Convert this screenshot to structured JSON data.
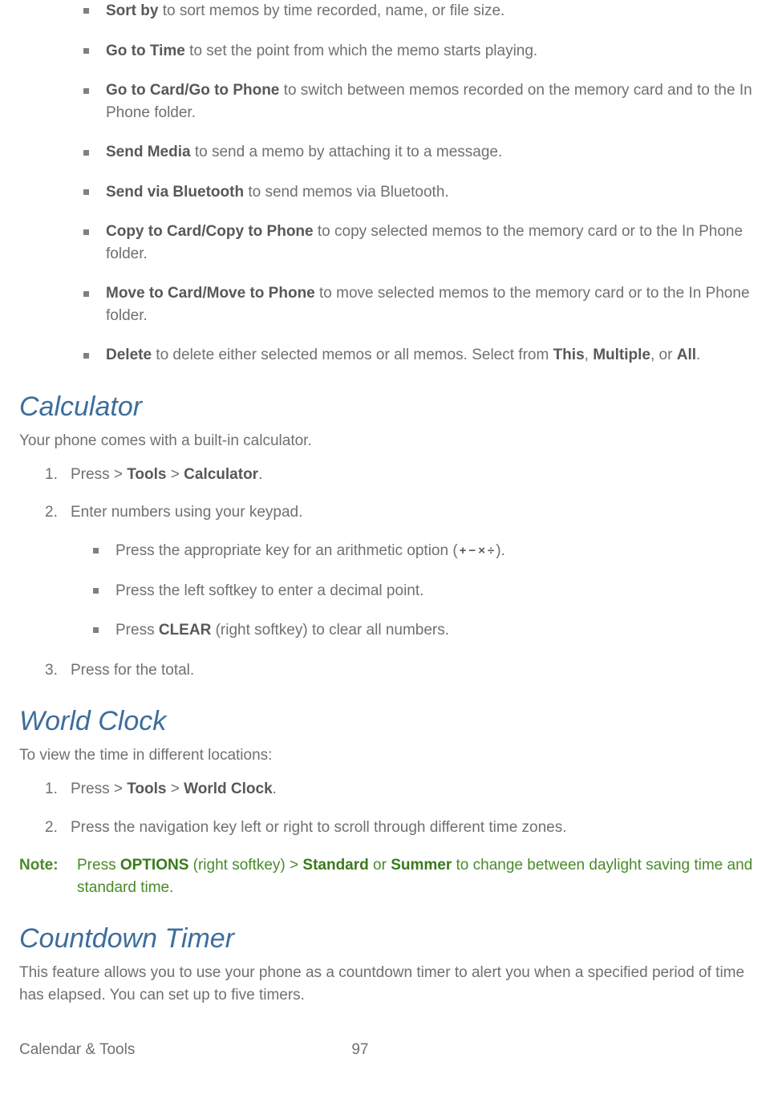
{
  "memo_options": [
    {
      "bold": "Sort by",
      "text": " to sort memos by time recorded, name, or file size."
    },
    {
      "bold": "Go to Time",
      "text": " to set the point from which the memo starts playing."
    },
    {
      "bold": "Go to Card/Go to Phone",
      "text": " to switch between memos recorded on the memory card and to the In Phone folder."
    },
    {
      "bold": "Send Media",
      "text": " to send a memo by attaching it to a message."
    },
    {
      "bold": "Send via Bluetooth",
      "text": " to send memos via Bluetooth."
    },
    {
      "bold": "Copy to Card/Copy to Phone",
      "text": " to copy selected memos to the memory card or to the In Phone folder."
    },
    {
      "bold": "Move to Card/Move to Phone",
      "text": " to move selected memos to the memory card or to the In Phone folder."
    }
  ],
  "delete_item": {
    "bold": "Delete",
    "t1": " to delete either selected memos or all memos. Select from ",
    "b1": "This",
    "sep1": ", ",
    "b2": "Multiple",
    "sep2": ", or ",
    "b3": "All",
    "tail": "."
  },
  "calc": {
    "heading": "Calculator",
    "intro": "Your phone comes with a built-in calculator.",
    "s1_a": "Press  > ",
    "s1_b": "Tools",
    "s1_c": " > ",
    "s1_d": "Calculator",
    "s1_e": ".",
    "s2": "Enter numbers using your keypad.",
    "sub1_a": "Press the appropriate key for an arithmetic option (",
    "sub1_b": ").",
    "ops": {
      "p": "+",
      "m": "−",
      "x": "×",
      "d": "÷"
    },
    "sub2": "Press the left softkey to enter a decimal point.",
    "sub3_a": "Press ",
    "sub3_b": "CLEAR",
    "sub3_c": " (right softkey) to clear all numbers.",
    "s3": "Press  for the total."
  },
  "wc": {
    "heading": "World Clock",
    "intro": "To view the time in different locations:",
    "s1_a": "Press  > ",
    "s1_b": "Tools",
    "s1_c": " > ",
    "s1_d": "World Clock",
    "s1_e": ".",
    "s2": "Press the navigation key left or right to scroll through different time zones."
  },
  "note": {
    "label": "Note:",
    "a": "Press ",
    "b1": "OPTIONS",
    "c": " (right softkey) > ",
    "b2": "Standard",
    "d": " or ",
    "b3": "Summer",
    "e": " to change between daylight saving time and standard time."
  },
  "ct": {
    "heading": "Countdown Timer",
    "intro": "This feature allows you to use your phone as a countdown timer to alert you when a specified period of time has elapsed. You can set up to five timers."
  },
  "footer": {
    "title": "Calendar & Tools",
    "page": "97"
  }
}
